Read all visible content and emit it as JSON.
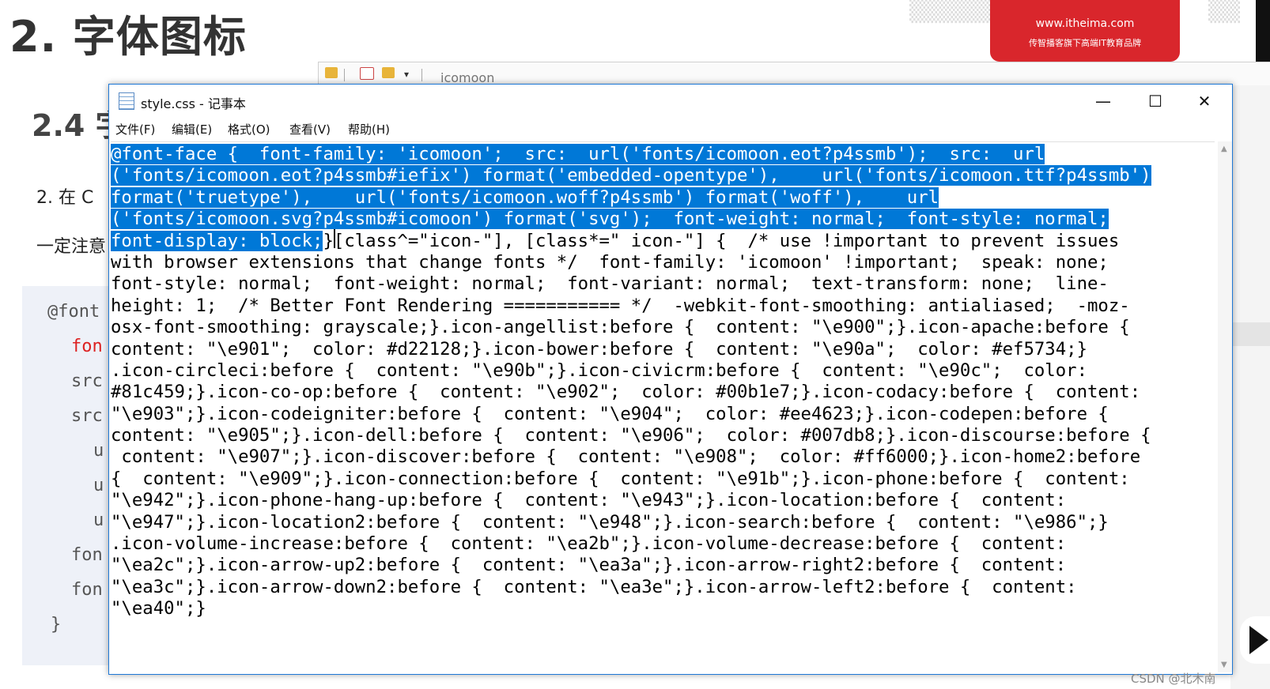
{
  "slide": {
    "title": "2. 字体图标",
    "subtitle": "2.4 字",
    "step_prefix": "2. 在 C",
    "note_prefix": "一定注意",
    "code_lines": [
      "@font",
      "fon",
      "src",
      "src",
      "u",
      "u",
      "u",
      "fon",
      "fon",
      "}"
    ],
    "logo_url": "www.itheima.com",
    "logo_slogan": "传智播客旗下高端IT教育品牌",
    "watermark": "CSDN @北木南"
  },
  "explorer": {
    "path_label": "icomoon"
  },
  "notepad": {
    "title": "style.css - 记事本",
    "menu": [
      "文件(F)",
      "编辑(E)",
      "格式(O)",
      "查看(V)",
      "帮助(H)"
    ],
    "window_buttons": {
      "minimize": "—",
      "maximize": "☐",
      "close": "✕"
    },
    "lines": [
      {
        "sel": "@font-face {  font-family: 'icomoon';  src:  url('fonts/icomoon.eot?p4ssmb');  src:  url",
        "rest": ""
      },
      {
        "sel": "('fonts/icomoon.eot?p4ssmb#iefix') format('embedded-opentype'),    url('fonts/icomoon.ttf?p4ssmb')",
        "rest": ""
      },
      {
        "sel": "format('truetype'),    url('fonts/icomoon.woff?p4ssmb') format('woff'),    url",
        "rest": ""
      },
      {
        "sel": "('fonts/icomoon.svg?p4ssmb#icomoon') format('svg');  font-weight: normal;  font-style: normal;",
        "rest": ""
      },
      {
        "sel": "font-display: block;",
        "rest": "}[class^=\"icon-\"], [class*=\" icon-\"] {  /* use !important to prevent issues"
      },
      {
        "sel": "",
        "rest": "with browser extensions that change fonts */  font-family: 'icomoon' !important;  speak: none;"
      },
      {
        "sel": "",
        "rest": "font-style: normal;  font-weight: normal;  font-variant: normal;  text-transform: none;  line-"
      },
      {
        "sel": "",
        "rest": "height: 1;  /* Better Font Rendering =========== */  -webkit-font-smoothing: antialiased;  -moz-"
      },
      {
        "sel": "",
        "rest": "osx-font-smoothing: grayscale;}.icon-angellist:before {  content: \"\\e900\";}.icon-apache:before {"
      },
      {
        "sel": "",
        "rest": "content: \"\\e901\";  color: #d22128;}.icon-bower:before {  content: \"\\e90a\";  color: #ef5734;}"
      },
      {
        "sel": "",
        "rest": ".icon-circleci:before {  content: \"\\e90b\";}.icon-civicrm:before {  content: \"\\e90c\";  color:"
      },
      {
        "sel": "",
        "rest": "#81c459;}.icon-co-op:before {  content: \"\\e902\";  color: #00b1e7;}.icon-codacy:before {  content:"
      },
      {
        "sel": "",
        "rest": "\"\\e903\";}.icon-codeigniter:before {  content: \"\\e904\";  color: #ee4623;}.icon-codepen:before {"
      },
      {
        "sel": "",
        "rest": "content: \"\\e905\";}.icon-dell:before {  content: \"\\e906\";  color: #007db8;}.icon-discourse:before {"
      },
      {
        "sel": "",
        "rest": " content: \"\\e907\";}.icon-discover:before {  content: \"\\e908\";  color: #ff6000;}.icon-home2:before"
      },
      {
        "sel": "",
        "rest": "{  content: \"\\e909\";}.icon-connection:before {  content: \"\\e91b\";}.icon-phone:before {  content:"
      },
      {
        "sel": "",
        "rest": "\"\\e942\";}.icon-phone-hang-up:before {  content: \"\\e943\";}.icon-location:before {  content:"
      },
      {
        "sel": "",
        "rest": "\"\\e947\";}.icon-location2:before {  content: \"\\e948\";}.icon-search:before {  content: \"\\e986\";}"
      },
      {
        "sel": "",
        "rest": ".icon-volume-increase:before {  content: \"\\ea2b\";}.icon-volume-decrease:before {  content:"
      },
      {
        "sel": "",
        "rest": "\"\\ea2c\";}.icon-arrow-up2:before {  content: \"\\ea3a\";}.icon-arrow-right2:before {  content:"
      },
      {
        "sel": "",
        "rest": "\"\\ea3c\";}.icon-arrow-down2:before {  content: \"\\ea3e\";}.icon-arrow-left2:before {  content:"
      },
      {
        "sel": "",
        "rest": "\"\\ea40\";}"
      }
    ]
  },
  "colors": {
    "selection": "#0078d7",
    "logo_red": "#d9262c",
    "window_border": "#1e78d6"
  }
}
